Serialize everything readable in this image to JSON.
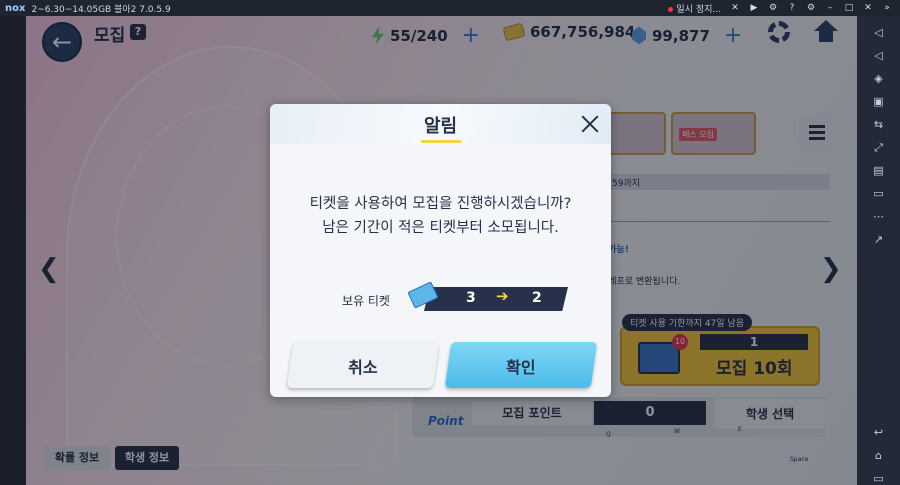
{
  "emulator": {
    "logo": "nox",
    "title": "2~6.30~14.05GB 블아2 7.0.5.9",
    "pause_label": "일시 정지..."
  },
  "hud": {
    "title": "모집",
    "help": "?",
    "stamina": "55/240",
    "credits": "667,756,984",
    "gems": "99,877"
  },
  "banner": {
    "pass_label": "페스 모집"
  },
  "info": {
    "line1": "59까지",
    "line2": "집가능!",
    "line3": "엘레프로 변환됩니다."
  },
  "recruit_ten": {
    "notice": "티켓 사용 기한까지 47일 남음",
    "ticket_badge": "10",
    "count": "1",
    "label": "모집 10회"
  },
  "points": {
    "logo": "Point",
    "label": "모집 포인트",
    "value": "0",
    "student_select": "학생 선택",
    "keys": [
      "Q",
      "W",
      "E",
      "Space"
    ]
  },
  "tabs": [
    "확률 정보",
    "학생 정보"
  ],
  "modal": {
    "title": "알림",
    "message_line1": "티켓을 사용하여 모집을 진행하시겠습니까?",
    "message_line2": "남은 기간이 적은 티켓부터 소모됩니다.",
    "ticket_label": "보유 티켓",
    "ticket_from": "3",
    "ticket_arrow": "➔",
    "ticket_to": "2",
    "cancel": "취소",
    "confirm": "확인"
  }
}
